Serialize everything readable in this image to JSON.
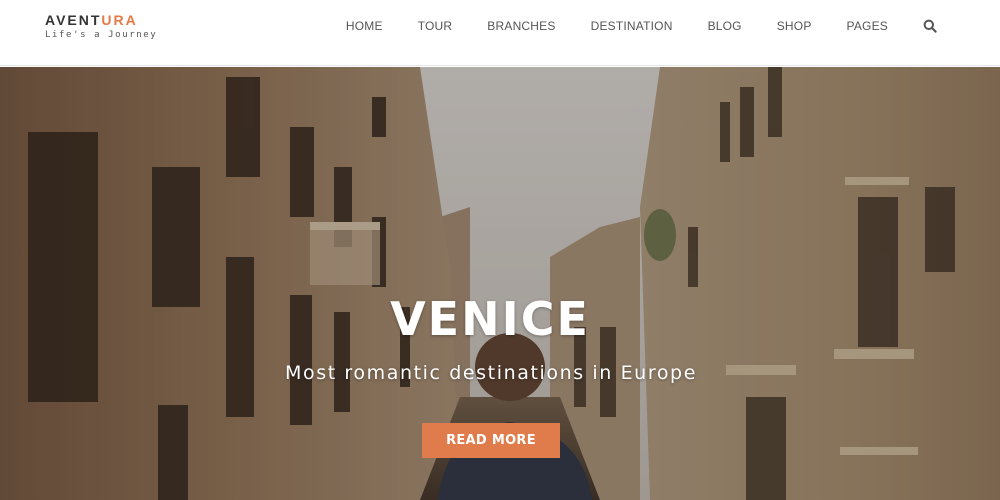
{
  "brand": {
    "name_dark": "AVENT",
    "name_accent": "URA",
    "tagline": "Life's a Journey",
    "accent_color": "#e47a46"
  },
  "nav": {
    "items": [
      {
        "label": "HOME"
      },
      {
        "label": "TOUR"
      },
      {
        "label": "BRANCHES"
      },
      {
        "label": "DESTINATION"
      },
      {
        "label": "BLOG"
      },
      {
        "label": "SHOP"
      },
      {
        "label": "PAGES"
      }
    ],
    "search_icon": "search-icon"
  },
  "hero": {
    "title": "VENICE",
    "subtitle": "Most romantic destinations in Europe",
    "cta_label": "READ MORE",
    "cta_color": "#e07c4c",
    "image": "venice-canal-street-photo"
  }
}
